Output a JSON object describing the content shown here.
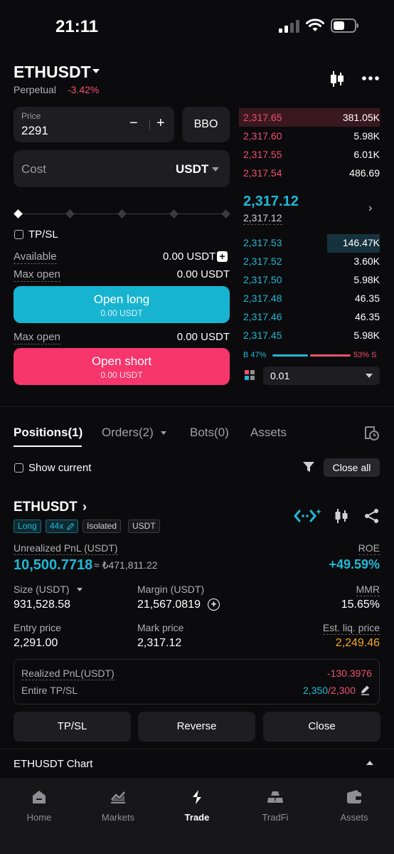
{
  "status_bar": {
    "time": "21:11"
  },
  "header": {
    "pair": "ETHUSDT",
    "contract_type": "Perpetual",
    "change": "-3.42%"
  },
  "order_form": {
    "price_label": "Price",
    "price_value": "2291",
    "minus": "−",
    "plus": "+",
    "bbo_label": "BBO",
    "cost_label": "Cost",
    "cost_unit": "USDT",
    "tpsl_label": "TP/SL",
    "available_label": "Available",
    "available_value": "0.00 USDT",
    "max_open_label": "Max open",
    "max_open_long_value": "0.00 USDT",
    "max_open_short_value": "0.00 USDT",
    "open_long_label": "Open long",
    "open_long_sub": "0.00 USDT",
    "open_short_label": "Open short",
    "open_short_sub": "0.00 USDT"
  },
  "order_book": {
    "asks": [
      {
        "price": "2,317.65",
        "qty": "381.05K"
      },
      {
        "price": "2,317.60",
        "qty": "5.98K"
      },
      {
        "price": "2,317.55",
        "qty": "6.01K"
      },
      {
        "price": "2,317.54",
        "qty": "486.69"
      }
    ],
    "mid_price": "2,317.12",
    "mark_price": "2,317.12",
    "bids": [
      {
        "price": "2,317.53",
        "qty": "146.47K"
      },
      {
        "price": "2,317.52",
        "qty": "3.60K"
      },
      {
        "price": "2,317.50",
        "qty": "5.98K"
      },
      {
        "price": "2,317.48",
        "qty": "46.35"
      },
      {
        "price": "2,317.46",
        "qty": "46.35"
      },
      {
        "price": "2,317.45",
        "qty": "5.98K"
      }
    ],
    "buy_ratio": "B 47%",
    "sell_ratio": "53% S",
    "depth_value": "0.01"
  },
  "tabs": [
    {
      "label": "Positions(1)"
    },
    {
      "label": "Orders(2)"
    },
    {
      "label": "Bots(0)"
    },
    {
      "label": "Assets"
    }
  ],
  "filters": {
    "show_current": "Show current",
    "close_all": "Close all"
  },
  "position": {
    "pair": "ETHUSDT",
    "tags": [
      "Long",
      "44x",
      "Isolated",
      "USDT"
    ],
    "unrealized_label": "Unrealized PnL (USDT)",
    "unrealized_value": "10,500.7718",
    "unrealized_approx": "≈ ₺471,811.22",
    "roe_label": "ROE",
    "roe_value": "+49.59%",
    "size_label": "Size (USDT)",
    "size_value": "931,528.58",
    "margin_label": "Margin (USDT)",
    "margin_value": "21,567.0819",
    "mmr_label": "MMR",
    "mmr_value": "15.65%",
    "entry_label": "Entry price",
    "entry_value": "2,291.00",
    "mark_label": "Mark price",
    "mark_value": "2,317.12",
    "liq_label": "Est. liq. price",
    "liq_value": "2,249.46",
    "realized_label": "Realized PnL(USDT)",
    "realized_value": "-130.3976",
    "entire_tpsl_label": "Entire TP/SL",
    "tp_value": "2,350",
    "sl_value": "/2,300",
    "actions": [
      "TP/SL",
      "Reverse",
      "Close"
    ]
  },
  "chart_section": {
    "title": "ETHUSDT  Chart"
  },
  "bottom_nav": [
    {
      "label": "Home"
    },
    {
      "label": "Markets"
    },
    {
      "label": "Trade"
    },
    {
      "label": "TradFi"
    },
    {
      "label": "Assets"
    }
  ],
  "colors": {
    "long": "#17b4d1",
    "short": "#f6356d",
    "background": "#0b0b0d",
    "liq": "#f5a623"
  }
}
